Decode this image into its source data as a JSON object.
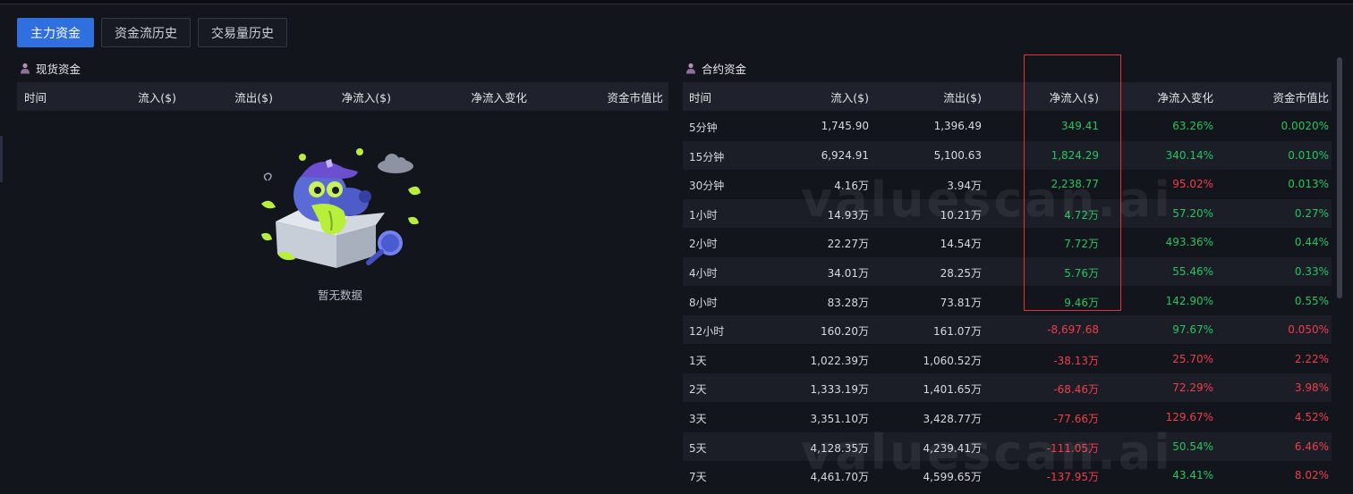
{
  "tabs": [
    {
      "label": "主力资金",
      "active": true
    },
    {
      "label": "资金流历史",
      "active": false
    },
    {
      "label": "交易量历史",
      "active": false
    }
  ],
  "spot": {
    "title": "现货资金",
    "columns": [
      "时间",
      "流入($)",
      "流出($)",
      "净流入($)",
      "净流入变化",
      "资金市值比"
    ],
    "empty_text": "暂无数据"
  },
  "futures": {
    "title": "合约资金",
    "columns": [
      "时间",
      "流入($)",
      "流出($)",
      "净流入($)",
      "净流入变化",
      "资金市值比"
    ],
    "rows": [
      {
        "time": "5分钟",
        "inflow": "1,745.90",
        "outflow": "1,396.49",
        "net": "349.41",
        "net_sign": "pos",
        "change": "63.26%",
        "change_sign": "pos",
        "ratio": "0.0020%",
        "ratio_sign": "pos"
      },
      {
        "time": "15分钟",
        "inflow": "6,924.91",
        "outflow": "5,100.63",
        "net": "1,824.29",
        "net_sign": "pos",
        "change": "340.14%",
        "change_sign": "pos",
        "ratio": "0.010%",
        "ratio_sign": "pos"
      },
      {
        "time": "30分钟",
        "inflow": "4.16万",
        "outflow": "3.94万",
        "net": "2,238.77",
        "net_sign": "pos",
        "change": "95.02%",
        "change_sign": "neg",
        "ratio": "0.013%",
        "ratio_sign": "pos"
      },
      {
        "time": "1小时",
        "inflow": "14.93万",
        "outflow": "10.21万",
        "net": "4.72万",
        "net_sign": "pos",
        "change": "57.20%",
        "change_sign": "pos",
        "ratio": "0.27%",
        "ratio_sign": "pos"
      },
      {
        "time": "2小时",
        "inflow": "22.27万",
        "outflow": "14.54万",
        "net": "7.72万",
        "net_sign": "pos",
        "change": "493.36%",
        "change_sign": "pos",
        "ratio": "0.44%",
        "ratio_sign": "pos"
      },
      {
        "time": "4小时",
        "inflow": "34.01万",
        "outflow": "28.25万",
        "net": "5.76万",
        "net_sign": "pos",
        "change": "55.46%",
        "change_sign": "pos",
        "ratio": "0.33%",
        "ratio_sign": "pos"
      },
      {
        "time": "8小时",
        "inflow": "83.28万",
        "outflow": "73.81万",
        "net": "9.46万",
        "net_sign": "pos",
        "change": "142.90%",
        "change_sign": "pos",
        "ratio": "0.55%",
        "ratio_sign": "pos"
      },
      {
        "time": "12小时",
        "inflow": "160.20万",
        "outflow": "161.07万",
        "net": "-8,697.68",
        "net_sign": "neg",
        "change": "97.67%",
        "change_sign": "pos",
        "ratio": "0.050%",
        "ratio_sign": "neg"
      },
      {
        "time": "1天",
        "inflow": "1,022.39万",
        "outflow": "1,060.52万",
        "net": "-38.13万",
        "net_sign": "neg",
        "change": "25.70%",
        "change_sign": "neg",
        "ratio": "2.22%",
        "ratio_sign": "neg"
      },
      {
        "time": "2天",
        "inflow": "1,333.19万",
        "outflow": "1,401.65万",
        "net": "-68.46万",
        "net_sign": "neg",
        "change": "72.29%",
        "change_sign": "neg",
        "ratio": "3.98%",
        "ratio_sign": "neg"
      },
      {
        "time": "3天",
        "inflow": "3,351.10万",
        "outflow": "3,428.77万",
        "net": "-77.66万",
        "net_sign": "neg",
        "change": "129.67%",
        "change_sign": "neg",
        "ratio": "4.52%",
        "ratio_sign": "neg"
      },
      {
        "time": "5天",
        "inflow": "4,128.35万",
        "outflow": "4,239.41万",
        "net": "-111.05万",
        "net_sign": "neg",
        "change": "50.54%",
        "change_sign": "pos",
        "ratio": "6.46%",
        "ratio_sign": "neg"
      },
      {
        "time": "7天",
        "inflow": "4,461.70万",
        "outflow": "4,599.65万",
        "net": "-137.95万",
        "net_sign": "neg",
        "change": "43.41%",
        "change_sign": "pos",
        "ratio": "8.02%",
        "ratio_sign": "neg"
      }
    ]
  },
  "watermark": "valuescan.ai",
  "colors": {
    "accent": "#2f6fdf",
    "positive": "#22c55e",
    "negative": "#ef3d4a",
    "highlight": "#e0343c"
  }
}
